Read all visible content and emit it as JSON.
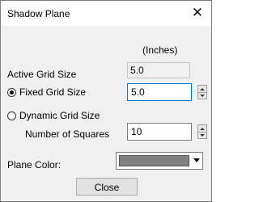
{
  "window": {
    "title": "Shadow Plane",
    "close_glyph": "✕"
  },
  "units_label": "(Inches)",
  "active_grid": {
    "label": "Active Grid Size",
    "value": "5.0"
  },
  "fixed_grid": {
    "label": "Fixed Grid Size",
    "value": "5.0",
    "selected": true
  },
  "dynamic_grid": {
    "label": "Dynamic Grid Size",
    "selected": false
  },
  "squares": {
    "label": "Number of Squares",
    "value": "10"
  },
  "plane_color": {
    "label": "Plane Color:",
    "swatch_color": "#808080"
  },
  "close_button_label": "Close",
  "icons": {
    "spinner": "spin-up-down-icon",
    "dropdown": "chevron-down-icon"
  }
}
